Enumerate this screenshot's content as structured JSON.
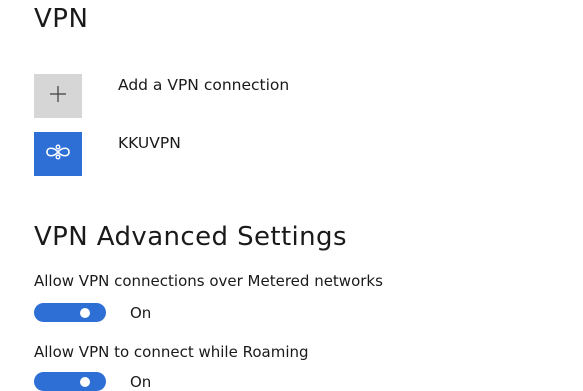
{
  "page": {
    "title": "VPN"
  },
  "vpn": {
    "add_label": "Add a VPN connection",
    "connections": [
      {
        "name": "KKUVPN"
      }
    ]
  },
  "advanced": {
    "title": "VPN Advanced Settings",
    "settings": [
      {
        "label": "Allow VPN connections over Metered networks",
        "state": "On",
        "on": true
      },
      {
        "label": "Allow VPN to connect while Roaming",
        "state": "On",
        "on": true
      }
    ]
  },
  "icons": {
    "add": "plus-icon",
    "connection": "vpn-network-icon"
  },
  "colors": {
    "accent": "#2e6fd6",
    "add_tile": "#d6d6d6",
    "text": "#1a1a1a"
  }
}
